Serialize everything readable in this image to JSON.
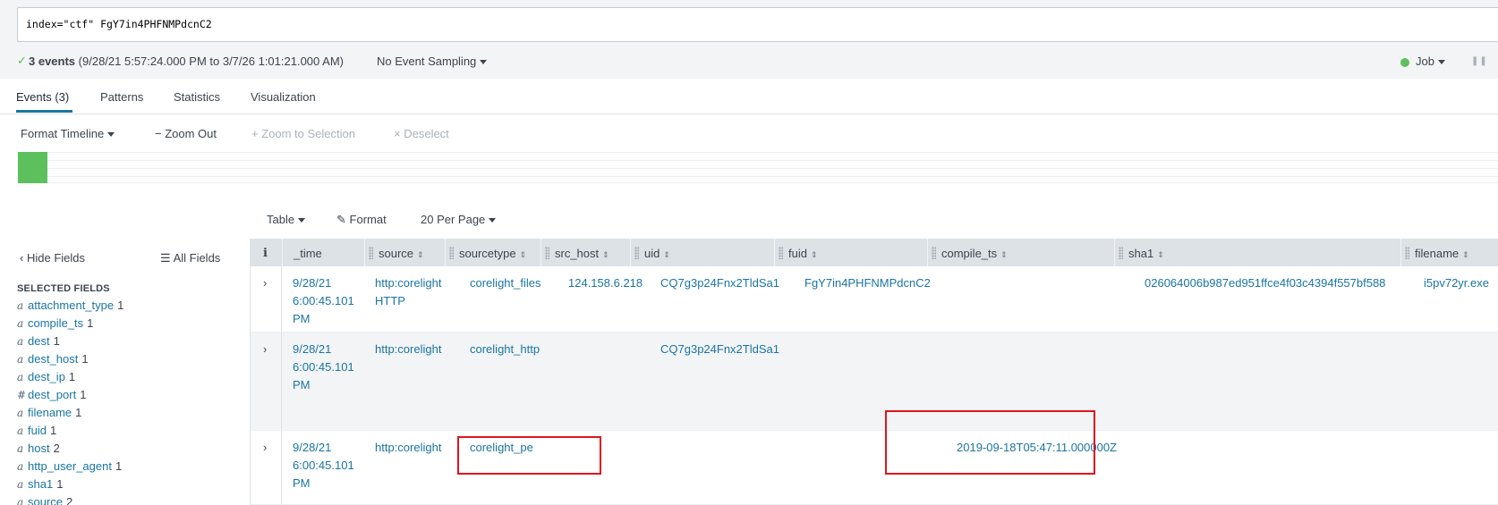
{
  "search": {
    "query": "index=\"ctf\" FgY7in4PHFNMPdcnC2"
  },
  "status": {
    "events_count": "3 events",
    "time_range": "(9/28/21 5:57:24.000 PM to 3/7/26 1:01:21.000 AM)",
    "sampling": "No Event Sampling",
    "job": "Job"
  },
  "tabs": [
    {
      "label": "Events (3)",
      "active": true
    },
    {
      "label": "Patterns"
    },
    {
      "label": "Statistics"
    },
    {
      "label": "Visualization"
    }
  ],
  "timeline_toolbar": {
    "format_timeline": "Format Timeline",
    "zoom_out": "Zoom Out",
    "zoom_to_selection": "Zoom to Selection",
    "deselect": "Deselect"
  },
  "results_toolbar": {
    "table": "Table",
    "format": "Format",
    "per_page": "20 Per Page"
  },
  "sidebar": {
    "hide_fields": "Hide Fields",
    "all_fields": "All Fields",
    "selected_heading": "SELECTED FIELDS",
    "fields": [
      {
        "type": "a",
        "name": "attachment_type",
        "count": "1"
      },
      {
        "type": "a",
        "name": "compile_ts",
        "count": "1"
      },
      {
        "type": "a",
        "name": "dest",
        "count": "1"
      },
      {
        "type": "a",
        "name": "dest_host",
        "count": "1"
      },
      {
        "type": "a",
        "name": "dest_ip",
        "count": "1"
      },
      {
        "type": "#",
        "name": "dest_port",
        "count": "1"
      },
      {
        "type": "a",
        "name": "filename",
        "count": "1"
      },
      {
        "type": "a",
        "name": "fuid",
        "count": "1"
      },
      {
        "type": "a",
        "name": "host",
        "count": "2"
      },
      {
        "type": "a",
        "name": "http_user_agent",
        "count": "1"
      },
      {
        "type": "a",
        "name": "sha1",
        "count": "1"
      },
      {
        "type": "a",
        "name": "source",
        "count": "2"
      }
    ]
  },
  "table": {
    "info_header": "i",
    "columns": [
      "_time",
      "source",
      "sourcetype",
      "src_host",
      "uid",
      "fuid",
      "compile_ts",
      "sha1",
      "filename"
    ],
    "rows": [
      {
        "time": [
          "9/28/21",
          "6:00:45.101",
          "PM"
        ],
        "source": [
          "http:corelight",
          "HTTP"
        ],
        "sourcetype": "corelight_files",
        "src_host": "124.158.6.218",
        "uid": "CQ7g3p24Fnx2TldSa1",
        "fuid": "FgY7in4PHFNMPdcnC2",
        "compile_ts": "",
        "sha1": "026064006b987ed951ffce4f03c4394f557bf588",
        "filename": "i5pv72yr.exe"
      },
      {
        "time": [
          "9/28/21",
          "6:00:45.101",
          "PM"
        ],
        "source": [
          "http:corelight",
          ""
        ],
        "sourcetype": "corelight_http",
        "src_host": "",
        "uid": "CQ7g3p24Fnx2TldSa1",
        "fuid": "",
        "compile_ts": "",
        "sha1": "",
        "filename": ""
      },
      {
        "time": [
          "9/28/21",
          "6:00:45.101",
          "PM"
        ],
        "source": [
          "http:corelight",
          ""
        ],
        "sourcetype": "corelight_pe",
        "src_host": "",
        "uid": "",
        "fuid": "",
        "compile_ts": "2019-09-18T05:47:11.000000Z",
        "sha1": "",
        "filename": ""
      }
    ]
  },
  "colors": {
    "accent": "#1a75a2",
    "success": "#5cc05c",
    "highlight": "#e0141e"
  }
}
